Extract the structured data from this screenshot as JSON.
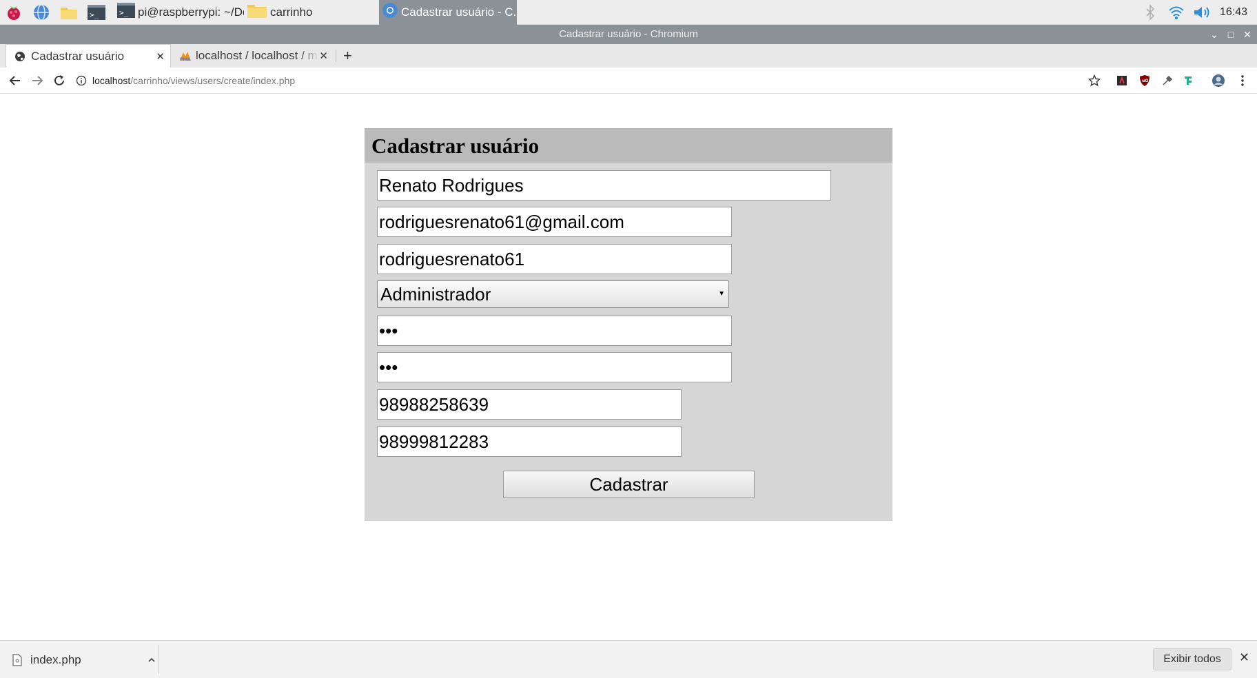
{
  "taskbar": {
    "tasks": [
      {
        "label": "pi@raspberrypi: ~/Do..."
      },
      {
        "label": "carrinho"
      },
      {
        "label": "Cadastrar usuário - C..."
      }
    ],
    "clock": "16:43"
  },
  "window": {
    "title": "Cadastrar usuário - Chromium"
  },
  "tabs": [
    {
      "label": "Cadastrar usuário"
    },
    {
      "label": "localhost / localhost / m"
    }
  ],
  "url": {
    "host": "localhost",
    "path": "/carrinho/views/users/create/index.php"
  },
  "form": {
    "heading": "Cadastrar usuário",
    "name": "Renato Rodrigues",
    "email": "rodriguesrenato61@gmail.com",
    "username": "rodriguesrenato61",
    "role": "Administrador",
    "password": "•••",
    "password_confirm": "•••",
    "phone1": "98988258639",
    "phone2": "98999812283",
    "submit_label": "Cadastrar"
  },
  "downloads": {
    "file": "index.php",
    "show_all_label": "Exibir todos"
  }
}
